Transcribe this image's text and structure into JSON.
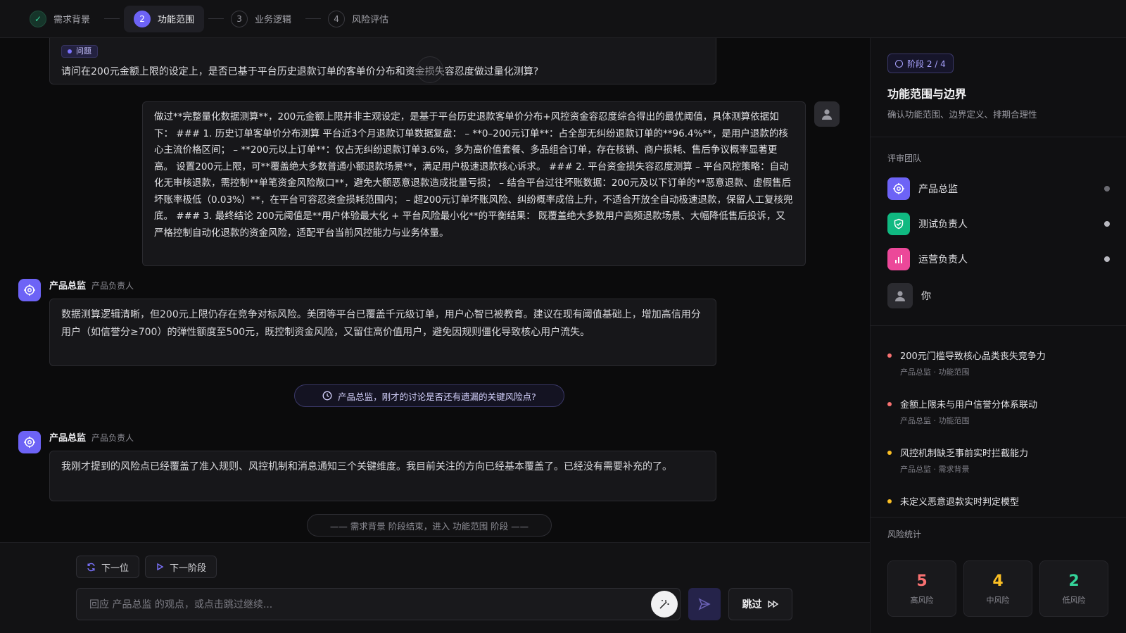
{
  "steps": [
    {
      "num": "✓",
      "label": "需求背景",
      "state": "done"
    },
    {
      "num": "2",
      "label": "功能范围",
      "state": "active"
    },
    {
      "num": "3",
      "label": "业务逻辑",
      "state": "pending"
    },
    {
      "num": "4",
      "label": "风险评估",
      "state": "pending"
    }
  ],
  "chat": {
    "question_tag": "问题",
    "question_text": "请问在200元金额上限的设定上，是否已基于平台历史退款订单的客单价分布和资金损失容忍度做过量化测算?",
    "user_reply": "做过**完整量化数据测算**，200元金额上限并非主观设定，是基于平台历史退款客单价分布+风控资金容忍度综合得出的最优阈值，具体测算依据如下： ### 1. 历史订单客单价分布测算 平台近3个月退款订单数据复盘： – **0–200元订单**：占全部无纠纷退款订单的**96.4%**，是用户退款的核心主流价格区间； – **200元以上订单**：仅占无纠纷退款订单3.6%，多为高价值套餐、多品组合订单，存在核销、商户损耗、售后争议概率显著更高。 设置200元上限，可**覆盖绝大多数普通小额退款场景**，满足用户极速退款核心诉求。 ### 2. 平台资金损失容忍度测算 – 平台风控策略：自动化无审核退款，需控制**单笔资金风险敞口**，避免大额恶意退款造成批量亏损； – 结合平台过往坏账数据：200元及以下订单的**恶意退款、虚假售后坏账率极低（0.03%）**，在平台可容忍资金损耗范围内； – 超200元订单坏账风险、纠纷概率成倍上升，不适合开放全自动极速退款，保留人工复核兜底。 ### 3. 最终结论 200元阈值是**用户体验最大化 + 平台风险最小化**的平衡结果： 既覆盖绝大多数用户高频退款场景、大幅降低售后投诉，又严格控制自动化退款的资金风险，适配平台当前风控能力与业务体量。",
    "agent1_name": "产品总监",
    "agent1_role": "产品负责人",
    "agent1_text": "数据测算逻辑清晰，但200元上限仍存在竞争对标风险。美团等平台已覆盖千元级订单，用户心智已被教育。建议在现有阈值基础上，增加高信用分用户（如信誉分≥700）的弹性额度至500元，既控制资金风险，又留住高价值用户，避免因规则僵化导致核心用户流失。",
    "prompt_pill": "产品总监，刚才的讨论是否还有遗漏的关键风险点?",
    "agent2_name": "产品总监",
    "agent2_role": "产品负责人",
    "agent2_text": "我刚才提到的风险点已经覆盖了准入规则、风控机制和消息通知三个关键维度。我目前关注的方向已经基本覆盖了。已经没有需要补充的了。",
    "stage_pill": "—— 需求背景 阶段结束，进入 功能范围 阶段 ——"
  },
  "bottom": {
    "next_person": "下一位",
    "next_stage": "下一阶段",
    "input_placeholder": "回应 产品总监 的观点，或点击跳过继续...",
    "skip": "跳过"
  },
  "sidebar": {
    "phase_badge": "阶段 2 / 4",
    "title": "功能范围与边界",
    "subtitle": "确认功能范围、边界定义、排期合理性",
    "team_label": "评审团队",
    "team": [
      {
        "name": "产品总监",
        "color": "#6d63f6",
        "icon": "target-icon"
      },
      {
        "name": "测试负责人",
        "color": "#10b981",
        "icon": "shield-icon"
      },
      {
        "name": "运营负责人",
        "color": "#ec4899",
        "icon": "bar-chart-icon"
      },
      {
        "name": "你",
        "color": "#2b2b30",
        "icon": "user-icon"
      }
    ],
    "risks": [
      {
        "title": "200元门槛导致核心品类丧失竞争力",
        "meta": "产品总监 · 功能范围",
        "color": "#f87171"
      },
      {
        "title": "金额上限未与用户信誉分体系联动",
        "meta": "产品总监 · 功能范围",
        "color": "#f87171"
      },
      {
        "title": "风控机制缺乏事前实时拦截能力",
        "meta": "产品总监 · 需求背景",
        "color": "#fbbf24"
      },
      {
        "title": "未定义恶意退款实时判定模型",
        "meta": "",
        "color": "#fbbf24"
      }
    ],
    "stats_label": "风险统计",
    "stats": [
      {
        "num": "5",
        "label": "高风险",
        "color": "#f87171"
      },
      {
        "num": "4",
        "label": "中风险",
        "color": "#fbbf24"
      },
      {
        "num": "2",
        "label": "低风险",
        "color": "#34d399"
      }
    ]
  }
}
